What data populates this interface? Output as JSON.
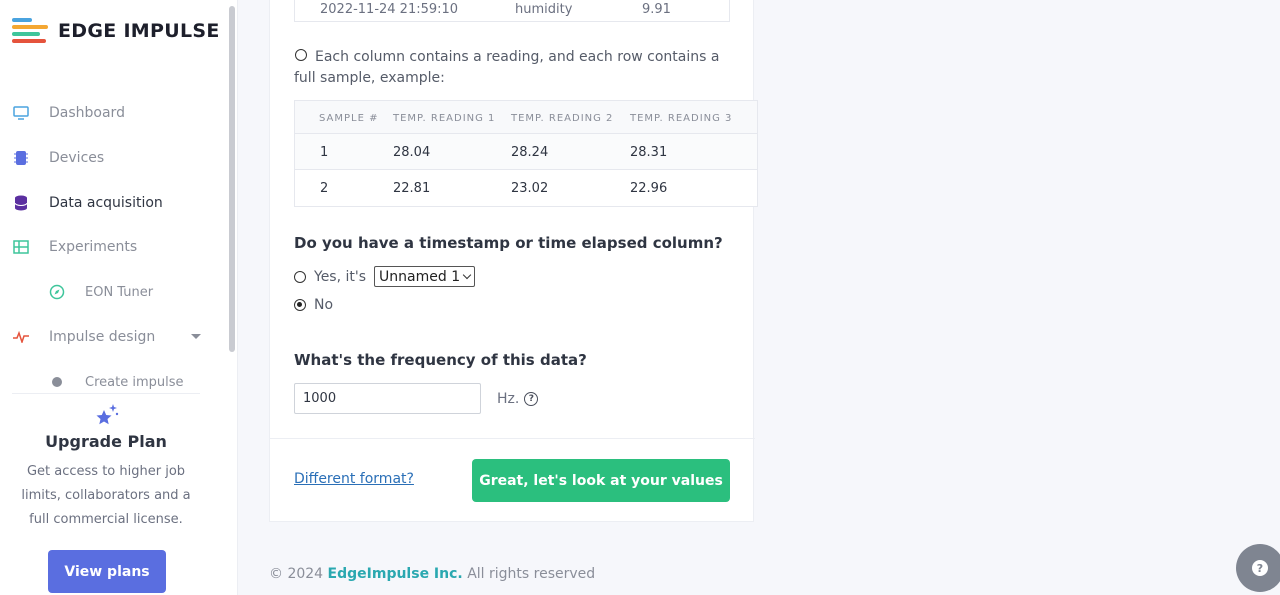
{
  "brand": {
    "name": "EDGE IMPULSE"
  },
  "sidebar": {
    "items": [
      {
        "label": "Dashboard",
        "icon": "monitor-icon"
      },
      {
        "label": "Devices",
        "icon": "chip-icon"
      },
      {
        "label": "Data acquisition",
        "icon": "database-icon",
        "active": true
      },
      {
        "label": "Experiments",
        "icon": "grid-icon"
      },
      {
        "label": "EON Tuner",
        "icon": "compass-icon"
      },
      {
        "label": "Impulse design",
        "icon": "pulse-icon"
      },
      {
        "label": "Create impulse",
        "icon": "dot-icon"
      }
    ]
  },
  "upgrade": {
    "title": "Upgrade Plan",
    "text": "Get access to higher job limits, collaborators and a full commercial license.",
    "button": "View plans"
  },
  "prev_table": {
    "row": [
      "2022-11-24 21:59:10",
      "humidity",
      "9.91"
    ]
  },
  "option_columns": {
    "text": "Each column contains a reading, and each row contains a full sample, example:"
  },
  "sample_table": {
    "headers": [
      "SAMPLE #",
      "TEMP. READING 1",
      "TEMP. READING 2",
      "TEMP. READING 3"
    ],
    "rows": [
      [
        "1",
        "28.04",
        "28.24",
        "28.31"
      ],
      [
        "2",
        "22.81",
        "23.02",
        "22.96"
      ]
    ]
  },
  "timestamp": {
    "question": "Do you have a timestamp or time elapsed column?",
    "yes_label": "Yes, it's",
    "select_value": "Unnamed 1",
    "no_label": "No"
  },
  "frequency": {
    "question": "What's the frequency of this data?",
    "value": "1000",
    "unit": "Hz."
  },
  "actions": {
    "different_format": "Different format?",
    "confirm": "Great, let's look at your values"
  },
  "footer": {
    "copyright": "© 2024",
    "company": "EdgeImpulse Inc.",
    "rights": "All rights reserved"
  },
  "colors": {
    "accent": "#5a6ee0",
    "confirm": "#2bbf7e",
    "brand_link": "#2aa8b0"
  }
}
